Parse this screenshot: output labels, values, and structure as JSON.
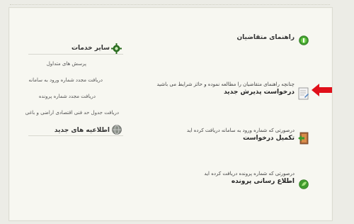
{
  "right_panel": {
    "guide_title": "راهنمای متقاضیان",
    "new_request": {
      "description": "چنانچه راهنمای متقاضیان را مطالعه نموده و حائز شرایط می باشید",
      "title": "درخواست پذیرش جدید"
    },
    "complete_request": {
      "description": "درصورتی که شماره ورود به سامانه دریافت کرده اید",
      "title": "تکمیل درخواست"
    },
    "notify_file": {
      "description": "درصورتی که شماره پرونده دریافت کرده اید",
      "title": "اطلاع رسانی پرونده"
    }
  },
  "left_panel": {
    "other_services_title": "سایر خدمات",
    "links": [
      "پرسش های متداول",
      "دریافت مجدد شماره ورود به سامانه",
      "دریافت مجدد شماره پرونده",
      "دریافت جدول حد فنی اقتصادی اراضی و باغی"
    ],
    "news_title": "اطلاعیه های جدید"
  },
  "icons": {
    "guide": "green-circle-icon",
    "new_request": "document-icon",
    "pointer": "red-arrow-icon",
    "complete": "door-exit-icon",
    "notify": "green-leaf-icon",
    "services": "green-gear-icon",
    "news": "gray-globe-icon"
  }
}
